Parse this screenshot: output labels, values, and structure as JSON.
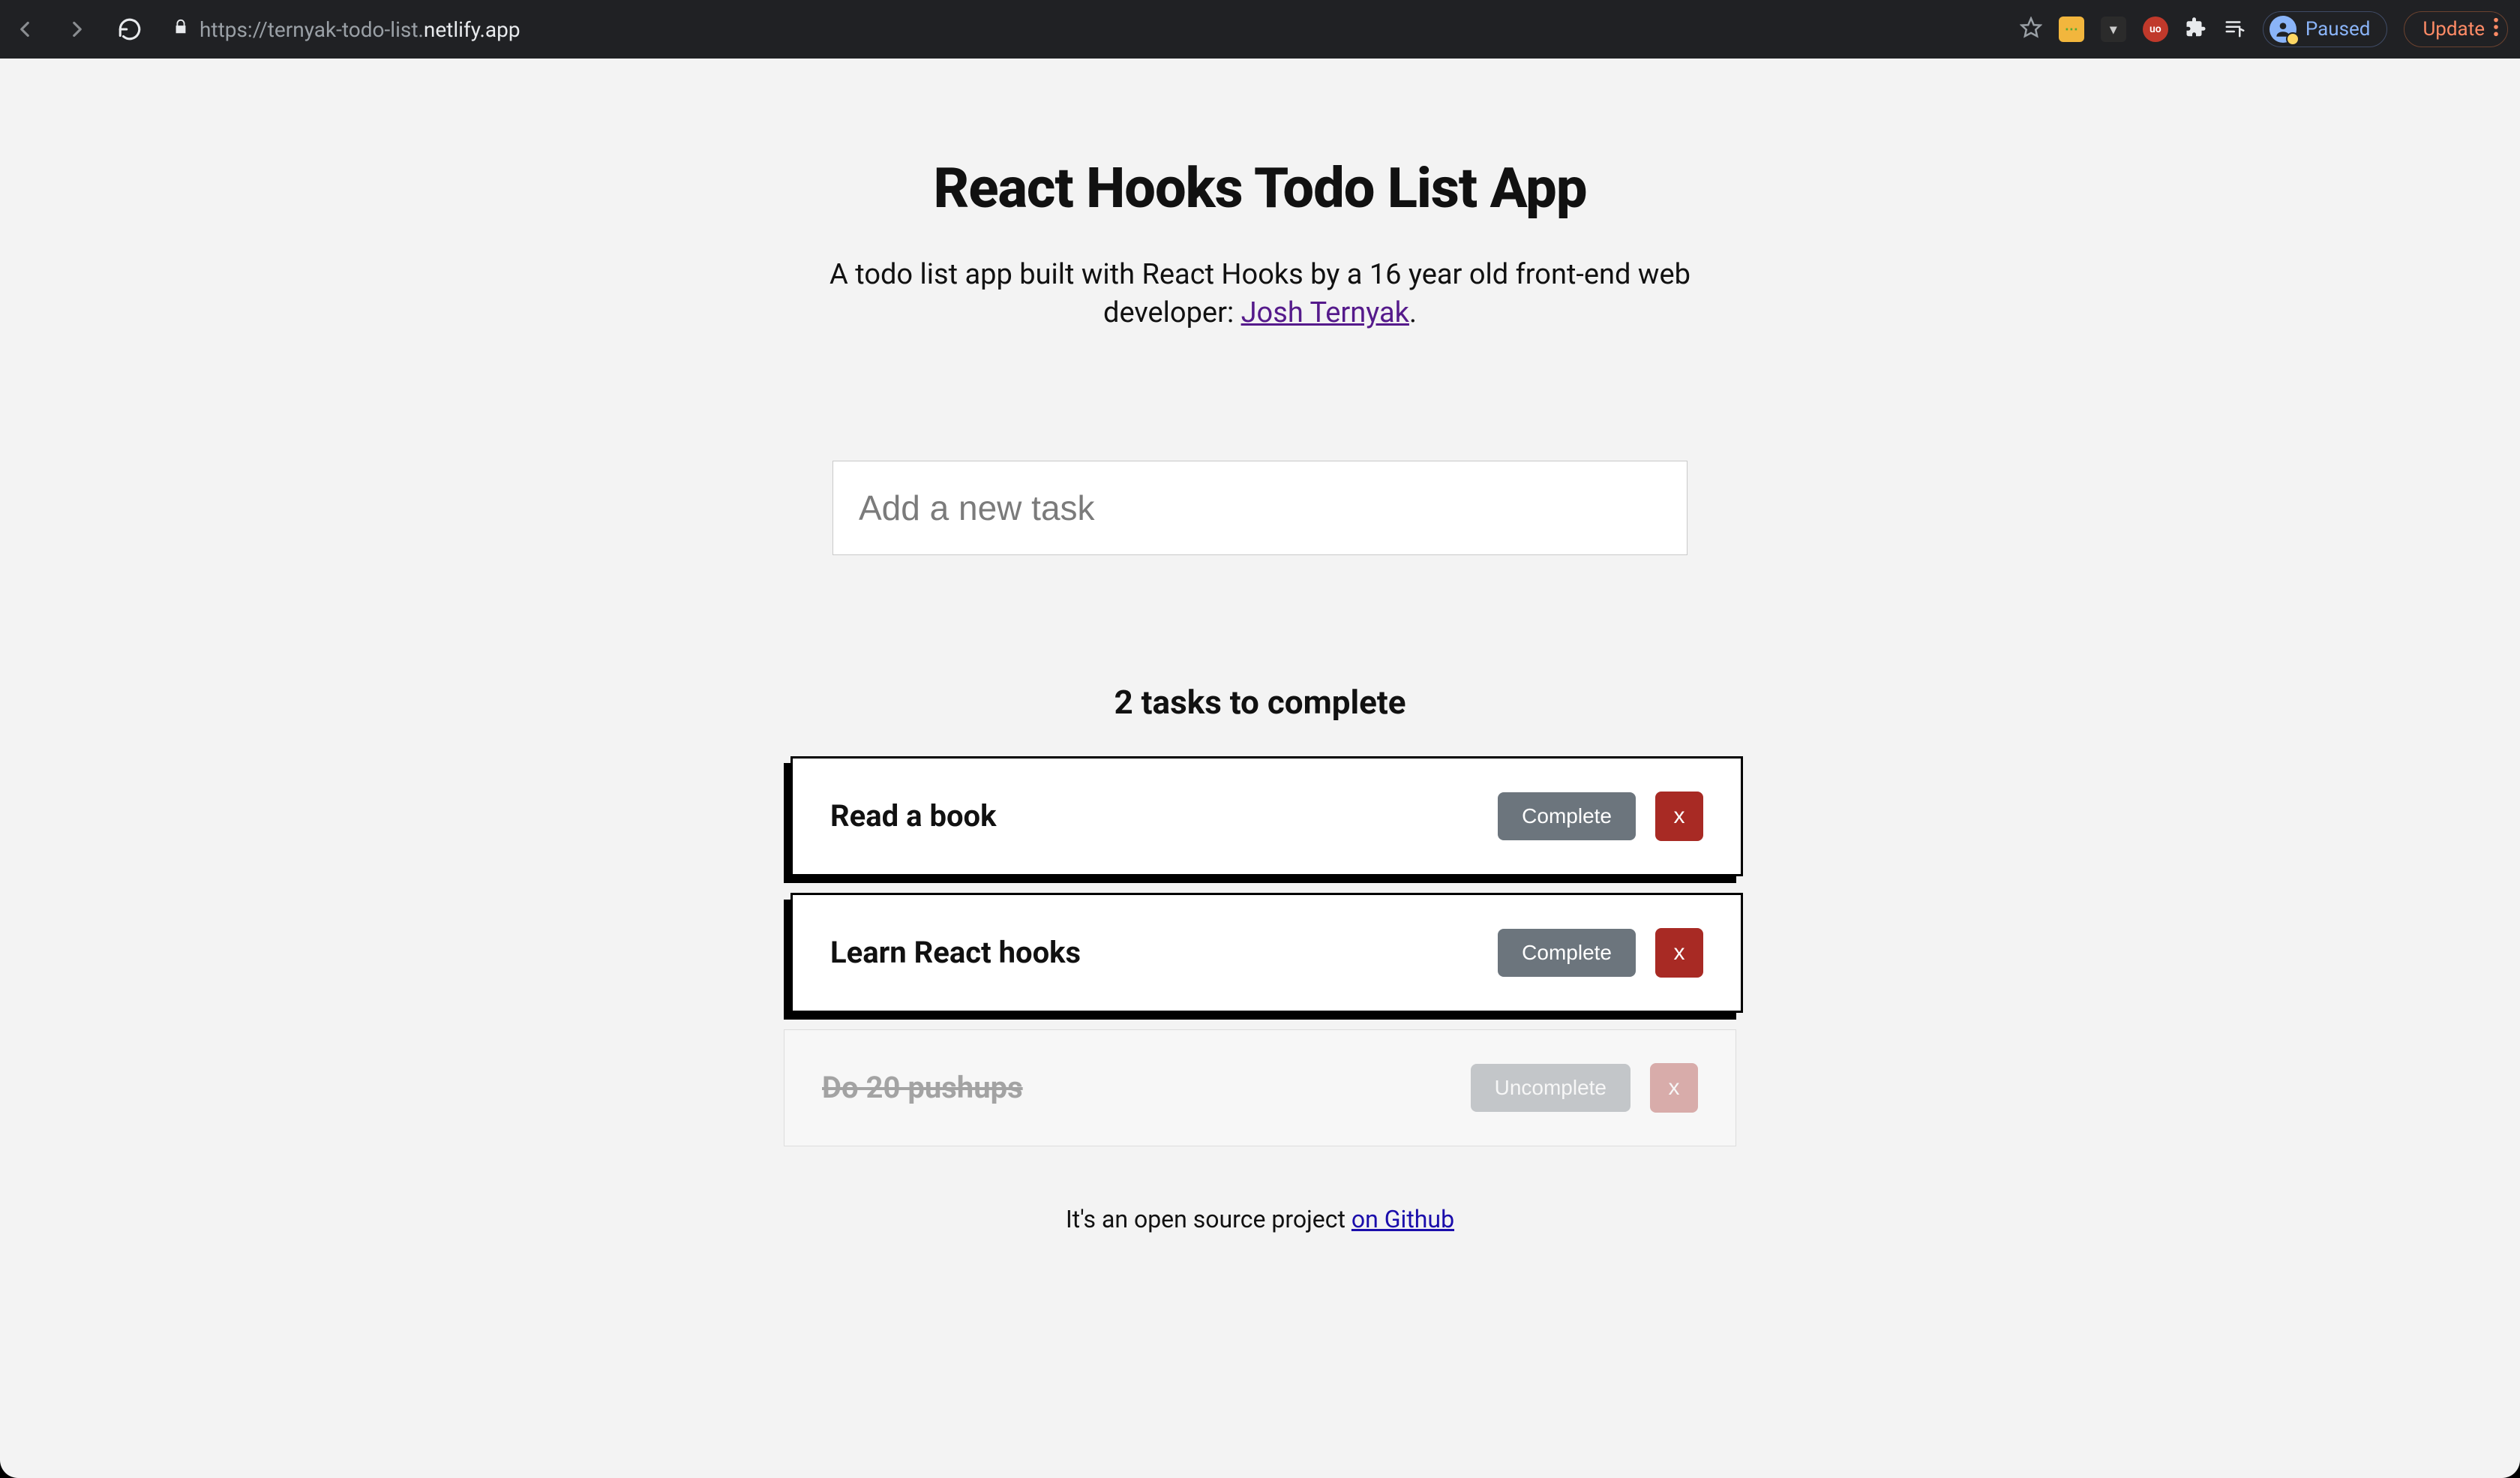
{
  "chrome": {
    "url_prefix": "https://ternyak-todo-list.",
    "url_host": "netlify.app",
    "paused_label": "Paused",
    "update_label": "Update"
  },
  "page": {
    "title": "React Hooks Todo List App",
    "subtitle_before": "A todo list app built with React Hooks by a 16 year old front-end web developer: ",
    "subtitle_link": "Josh Ternyak",
    "subtitle_after": ".",
    "input_placeholder": "Add a new task",
    "remaining_label": "2 tasks to complete",
    "footer_before": "It's an open source project ",
    "footer_link": "on Github",
    "complete_label": "Complete",
    "uncomplete_label": "Uncomplete",
    "delete_label": "x"
  },
  "todos": [
    {
      "title": "Read a book",
      "completed": false
    },
    {
      "title": "Learn React hooks",
      "completed": false
    },
    {
      "title": "Do 20 pushups",
      "completed": true
    }
  ]
}
